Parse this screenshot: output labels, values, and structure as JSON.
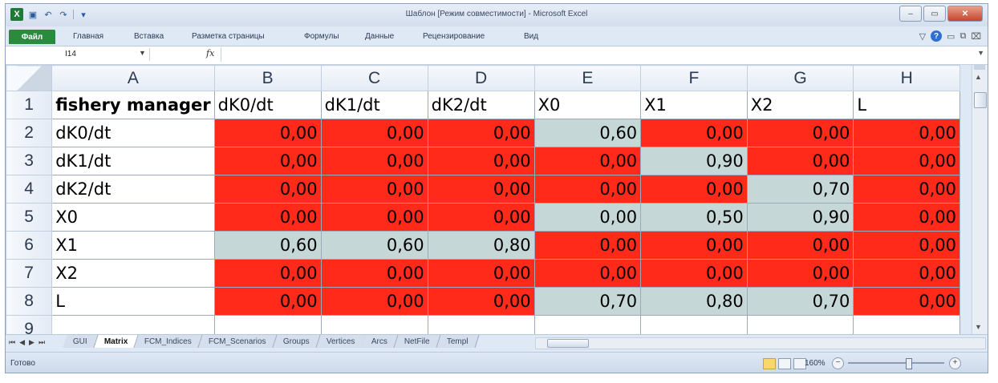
{
  "window": {
    "title": "Шаблон  [Режим совместимости]  -  Microsoft Excel",
    "buttons": [
      "–",
      "▭",
      "✕"
    ]
  },
  "ribbon": {
    "file": "Файл",
    "tabs": [
      "Главная",
      "Вставка",
      "Разметка страницы",
      "Формулы",
      "Данные",
      "Рецензирование",
      "Вид"
    ]
  },
  "formula_bar": {
    "name_box": "I14",
    "fx": "fx",
    "value": ""
  },
  "sheet": {
    "columns": [
      "A",
      "B",
      "C",
      "D",
      "E",
      "F",
      "G",
      "H"
    ],
    "row_numbers": [
      "1",
      "2",
      "3",
      "4",
      "5",
      "6",
      "7",
      "8",
      "9"
    ],
    "header_row": [
      "fishery manager",
      "dK0/dt",
      "dK1/dt",
      "dK2/dt",
      "X0",
      "X1",
      "X2",
      "L"
    ],
    "rows": [
      {
        "label": "dK0/dt",
        "values": [
          "0,00",
          "0,00",
          "0,00",
          "0,60",
          "0,00",
          "0,00",
          "0,00"
        ],
        "fills": [
          "red",
          "red",
          "red",
          "grey",
          "red",
          "red",
          "red"
        ]
      },
      {
        "label": "dK1/dt",
        "values": [
          "0,00",
          "0,00",
          "0,00",
          "0,00",
          "0,90",
          "0,00",
          "0,00"
        ],
        "fills": [
          "red",
          "red",
          "red",
          "red",
          "grey",
          "red",
          "red"
        ]
      },
      {
        "label": "dK2/dt",
        "values": [
          "0,00",
          "0,00",
          "0,00",
          "0,00",
          "0,00",
          "0,70",
          "0,00"
        ],
        "fills": [
          "red",
          "red",
          "red",
          "red",
          "red",
          "grey",
          "red"
        ]
      },
      {
        "label": "X0",
        "values": [
          "0,00",
          "0,00",
          "0,00",
          "0,00",
          "0,50",
          "0,90",
          "0,00"
        ],
        "fills": [
          "red",
          "red",
          "red",
          "grey",
          "grey",
          "grey",
          "red"
        ]
      },
      {
        "label": "X1",
        "values": [
          "0,60",
          "0,60",
          "0,80",
          "0,00",
          "0,00",
          "0,00",
          "0,00"
        ],
        "fills": [
          "grey",
          "grey",
          "grey",
          "red",
          "red",
          "red",
          "red"
        ]
      },
      {
        "label": "X2",
        "values": [
          "0,00",
          "0,00",
          "0,00",
          "0,00",
          "0,00",
          "0,00",
          "0,00"
        ],
        "fills": [
          "red",
          "red",
          "red",
          "red",
          "red",
          "red",
          "red"
        ]
      },
      {
        "label": "L",
        "values": [
          "0,00",
          "0,00",
          "0,00",
          "0,70",
          "0,80",
          "0,70",
          "0,00"
        ],
        "fills": [
          "red",
          "red",
          "red",
          "grey",
          "grey",
          "grey",
          "red"
        ]
      }
    ]
  },
  "sheet_tabs": {
    "tabs": [
      "GUI",
      "Matrix",
      "FCM_Indices",
      "FCM_Scenarios",
      "Groups",
      "Vertices",
      "Arcs",
      "NetFile",
      "Templ"
    ],
    "active": "Matrix"
  },
  "status": {
    "text": "Готово",
    "zoom": "160%"
  },
  "colors": {
    "red": "#ff2a1a",
    "grey": "#c6d7d7",
    "file_tab": "#2a8a3e"
  }
}
